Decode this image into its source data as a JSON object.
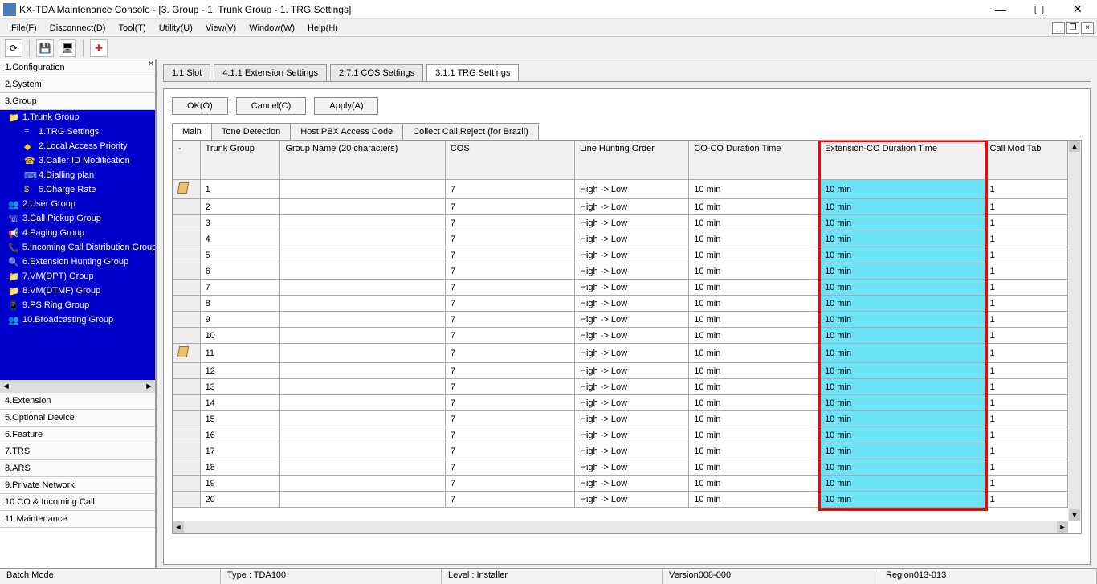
{
  "window": {
    "title": "KX-TDA Maintenance Console - [3. Group - 1. Trunk Group - 1. TRG Settings]"
  },
  "menu": {
    "file": "File(F)",
    "disconnect": "Disconnect(D)",
    "tool": "Tool(T)",
    "utility": "Utility(U)",
    "view": "View(V)",
    "windowm": "Window(W)",
    "help": "Help(H)"
  },
  "sidebar_top": {
    "i1": "1.Configuration",
    "i2": "2.System",
    "i3": "3.Group"
  },
  "tree": {
    "t0": "1.Trunk Group",
    "t1": "1.TRG Settings",
    "t2": "2.Local Access Priority",
    "t3": "3.Caller ID Modification",
    "t4": "4.Dialling plan",
    "t5": "5.Charge Rate",
    "g2": "2.User Group",
    "g3": "3.Call Pickup Group",
    "g4": "4.Paging Group",
    "g5": "5.Incoming Call Distribution Group",
    "g6": "6.Extension Hunting Group",
    "g7": "7.VM(DPT) Group",
    "g8": "8.VM(DTMF) Group",
    "g9": "9.PS Ring Group",
    "g10": "10.Broadcasting Group"
  },
  "sidebar_bottom": {
    "i4": "4.Extension",
    "i5": "5.Optional Device",
    "i6": "6.Feature",
    "i7": "7.TRS",
    "i8": "8.ARS",
    "i9": "9.Private Network",
    "i10": "10.CO & Incoming Call",
    "i11": "11.Maintenance"
  },
  "doctabs": {
    "t1": "1.1 Slot",
    "t2": "4.1.1 Extension Settings",
    "t3": "2.7.1 COS Settings",
    "t4": "3.1.1 TRG Settings"
  },
  "buttons": {
    "ok": "OK(O)",
    "cancel": "Cancel(C)",
    "apply": "Apply(A)"
  },
  "subtabs": {
    "s1": "Main",
    "s2": "Tone Detection",
    "s3": "Host PBX Access Code",
    "s4": "Collect Call Reject (for Brazil)"
  },
  "headers": {
    "h0": "-",
    "h1": "Trunk Group",
    "h2": "Group Name (20 characters)",
    "h3": "COS",
    "h4": "Line Hunting Order",
    "h5": "CO-CO Duration Time",
    "h6": "Extension-CO Duration Time",
    "h7": "Call Mod Tab"
  },
  "rows": [
    {
      "tag": true,
      "tg": "1",
      "gn": "",
      "cos": "7",
      "lho": "High -> Low",
      "coco": "10 min",
      "ext": "10 min",
      "cmt": "1"
    },
    {
      "tag": false,
      "tg": "2",
      "gn": "",
      "cos": "7",
      "lho": "High -> Low",
      "coco": "10 min",
      "ext": "10 min",
      "cmt": "1"
    },
    {
      "tag": false,
      "tg": "3",
      "gn": "",
      "cos": "7",
      "lho": "High -> Low",
      "coco": "10 min",
      "ext": "10 min",
      "cmt": "1"
    },
    {
      "tag": false,
      "tg": "4",
      "gn": "",
      "cos": "7",
      "lho": "High -> Low",
      "coco": "10 min",
      "ext": "10 min",
      "cmt": "1"
    },
    {
      "tag": false,
      "tg": "5",
      "gn": "",
      "cos": "7",
      "lho": "High -> Low",
      "coco": "10 min",
      "ext": "10 min",
      "cmt": "1"
    },
    {
      "tag": false,
      "tg": "6",
      "gn": "",
      "cos": "7",
      "lho": "High -> Low",
      "coco": "10 min",
      "ext": "10 min",
      "cmt": "1"
    },
    {
      "tag": false,
      "tg": "7",
      "gn": "",
      "cos": "7",
      "lho": "High -> Low",
      "coco": "10 min",
      "ext": "10 min",
      "cmt": "1"
    },
    {
      "tag": false,
      "tg": "8",
      "gn": "",
      "cos": "7",
      "lho": "High -> Low",
      "coco": "10 min",
      "ext": "10 min",
      "cmt": "1"
    },
    {
      "tag": false,
      "tg": "9",
      "gn": "",
      "cos": "7",
      "lho": "High -> Low",
      "coco": "10 min",
      "ext": "10 min",
      "cmt": "1"
    },
    {
      "tag": false,
      "tg": "10",
      "gn": "",
      "cos": "7",
      "lho": "High -> Low",
      "coco": "10 min",
      "ext": "10 min",
      "cmt": "1"
    },
    {
      "tag": true,
      "tg": "11",
      "gn": "",
      "cos": "7",
      "lho": "High -> Low",
      "coco": "10 min",
      "ext": "10 min",
      "cmt": "1"
    },
    {
      "tag": false,
      "tg": "12",
      "gn": "",
      "cos": "7",
      "lho": "High -> Low",
      "coco": "10 min",
      "ext": "10 min",
      "cmt": "1"
    },
    {
      "tag": false,
      "tg": "13",
      "gn": "",
      "cos": "7",
      "lho": "High -> Low",
      "coco": "10 min",
      "ext": "10 min",
      "cmt": "1"
    },
    {
      "tag": false,
      "tg": "14",
      "gn": "",
      "cos": "7",
      "lho": "High -> Low",
      "coco": "10 min",
      "ext": "10 min",
      "cmt": "1"
    },
    {
      "tag": false,
      "tg": "15",
      "gn": "",
      "cos": "7",
      "lho": "High -> Low",
      "coco": "10 min",
      "ext": "10 min",
      "cmt": "1"
    },
    {
      "tag": false,
      "tg": "16",
      "gn": "",
      "cos": "7",
      "lho": "High -> Low",
      "coco": "10 min",
      "ext": "10 min",
      "cmt": "1"
    },
    {
      "tag": false,
      "tg": "17",
      "gn": "",
      "cos": "7",
      "lho": "High -> Low",
      "coco": "10 min",
      "ext": "10 min",
      "cmt": "1"
    },
    {
      "tag": false,
      "tg": "18",
      "gn": "",
      "cos": "7",
      "lho": "High -> Low",
      "coco": "10 min",
      "ext": "10 min",
      "cmt": "1"
    },
    {
      "tag": false,
      "tg": "19",
      "gn": "",
      "cos": "7",
      "lho": "High -> Low",
      "coco": "10 min",
      "ext": "10 min",
      "cmt": "1"
    },
    {
      "tag": false,
      "tg": "20",
      "gn": "",
      "cos": "7",
      "lho": "High -> Low",
      "coco": "10 min",
      "ext": "10 min",
      "cmt": "1"
    }
  ],
  "status": {
    "batch": "Batch Mode:",
    "type": "Type : TDA100",
    "level": "Level : Installer",
    "version": "Version008-000",
    "region": "Region013-013"
  }
}
